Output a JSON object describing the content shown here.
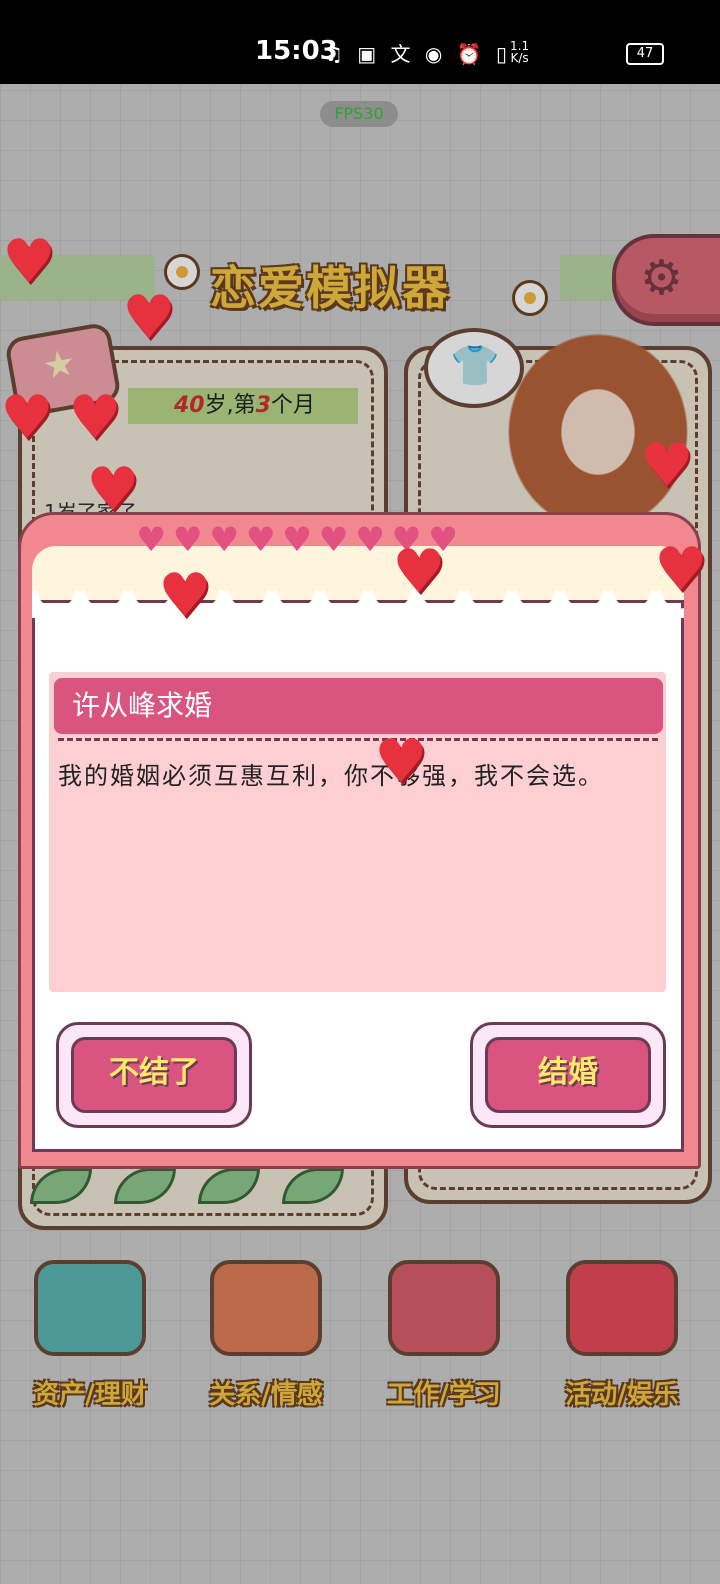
{
  "status_bar": {
    "time": "15:03",
    "network_speed_top": "1.1",
    "network_speed_bottom": "K/s",
    "battery": "47"
  },
  "fps": "FPS30",
  "game_title": "恋爱模拟器",
  "profile": {
    "age_text": "40",
    "age_suffix": "岁,第",
    "month_num": "3",
    "month_suffix": "个月",
    "log_line": "1岁了家了"
  },
  "dialog": {
    "title": "许从峰求婚",
    "message": "我的婚姻必须互惠互利，你不够强，我不会选。",
    "decline_label": "不结了",
    "accept_label": "结婚"
  },
  "bottom_nav": [
    {
      "label": "资产/理财",
      "icon": "piggy-bank-icon",
      "color": "#5bb7b5"
    },
    {
      "label": "关系/情感",
      "icon": "couple-cups-icon",
      "color": "#e27f5a"
    },
    {
      "label": "工作/学习",
      "icon": "book-icon",
      "color": "#d95f6a"
    },
    {
      "label": "活动/娱乐",
      "icon": "popcorn-icon",
      "color": "#e84b5c"
    }
  ],
  "colors": {
    "accent_pink": "#d9547f",
    "dialog_border": "#f1878f",
    "title_yellow": "#f6c747",
    "heart_red": "#e8313f"
  }
}
